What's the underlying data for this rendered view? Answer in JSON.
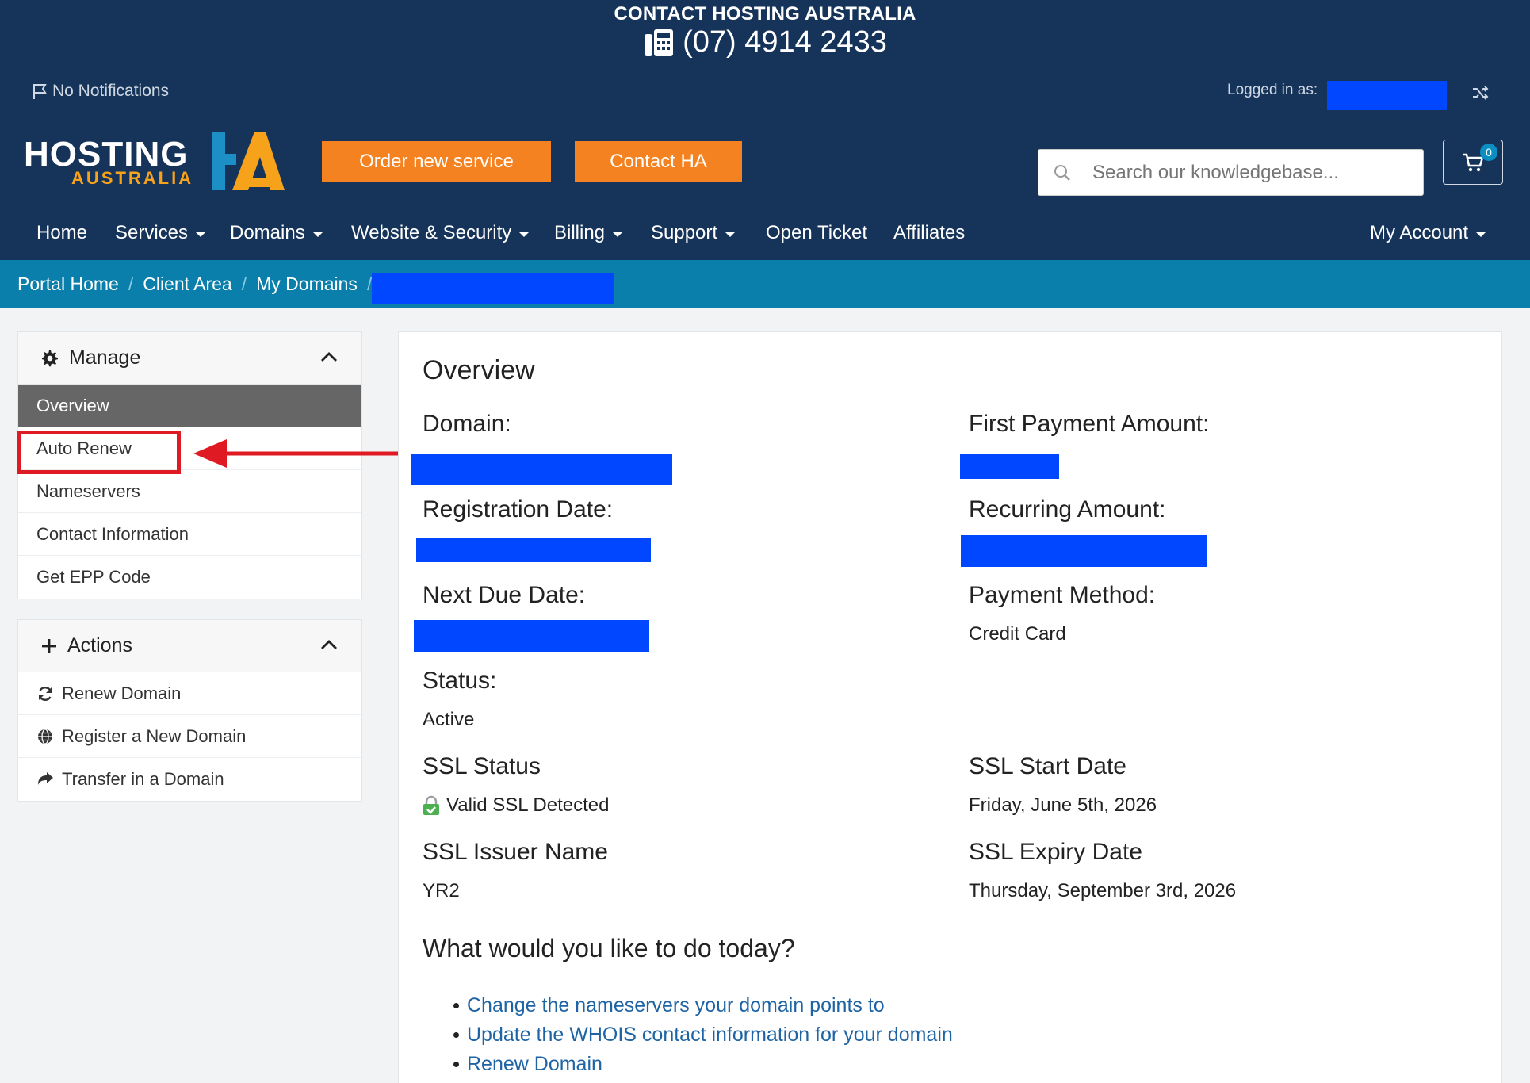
{
  "header": {
    "contact_title": "CONTACT HOSTING AUSTRALIA",
    "contact_phone": "(07) 4914 2433",
    "notifications": "No Notifications",
    "logged_in_label": "Logged in as:",
    "logo_line1": "HOSTING",
    "logo_line2": "AUSTRALIA",
    "order_button": "Order new service",
    "contact_button": "Contact HA",
    "search_placeholder": "Search our knowledgebase...",
    "cart_count": "0"
  },
  "nav": {
    "items": [
      "Home",
      "Services",
      "Domains",
      "Website & Security",
      "Billing",
      "Support",
      "Open Ticket",
      "Affiliates"
    ],
    "account": "My Account"
  },
  "breadcrumb": [
    "Portal Home",
    "Client Area",
    "My Domains"
  ],
  "sidebar": {
    "manage": {
      "title": "Manage",
      "items": [
        "Overview",
        "Auto Renew",
        "Nameservers",
        "Contact Information",
        "Get EPP Code"
      ]
    },
    "actions": {
      "title": "Actions",
      "items": [
        "Renew Domain",
        "Register a New Domain",
        "Transfer in a Domain"
      ]
    }
  },
  "overview": {
    "title": "Overview",
    "domain_label": "Domain:",
    "first_payment_label": "First Payment Amount:",
    "registration_label": "Registration Date:",
    "recurring_label": "Recurring Amount:",
    "next_due_label": "Next Due Date:",
    "payment_method_label": "Payment Method:",
    "payment_method_value": "Credit Card",
    "status_label": "Status:",
    "status_value": "Active",
    "ssl_status_label": "SSL Status",
    "ssl_status_value": "Valid SSL Detected",
    "ssl_start_label": "SSL Start Date",
    "ssl_start_value": "Friday, June 5th, 2026",
    "ssl_issuer_label": "SSL Issuer Name",
    "ssl_issuer_value": "YR2",
    "ssl_expiry_label": "SSL Expiry Date",
    "ssl_expiry_value": "Thursday, September 3rd, 2026",
    "question": "What would you like to do today?",
    "links": [
      "Change the nameservers your domain points to",
      "Update the WHOIS contact information for your domain",
      "Renew Domain"
    ]
  },
  "colors": {
    "header_bg": "#16345a",
    "breadcrumb_bg": "#0a7fab",
    "accent_orange": "#f58220",
    "link_blue": "#1e64a5",
    "redaction_blue": "#0047ff",
    "annotation_red": "#e01a22"
  }
}
